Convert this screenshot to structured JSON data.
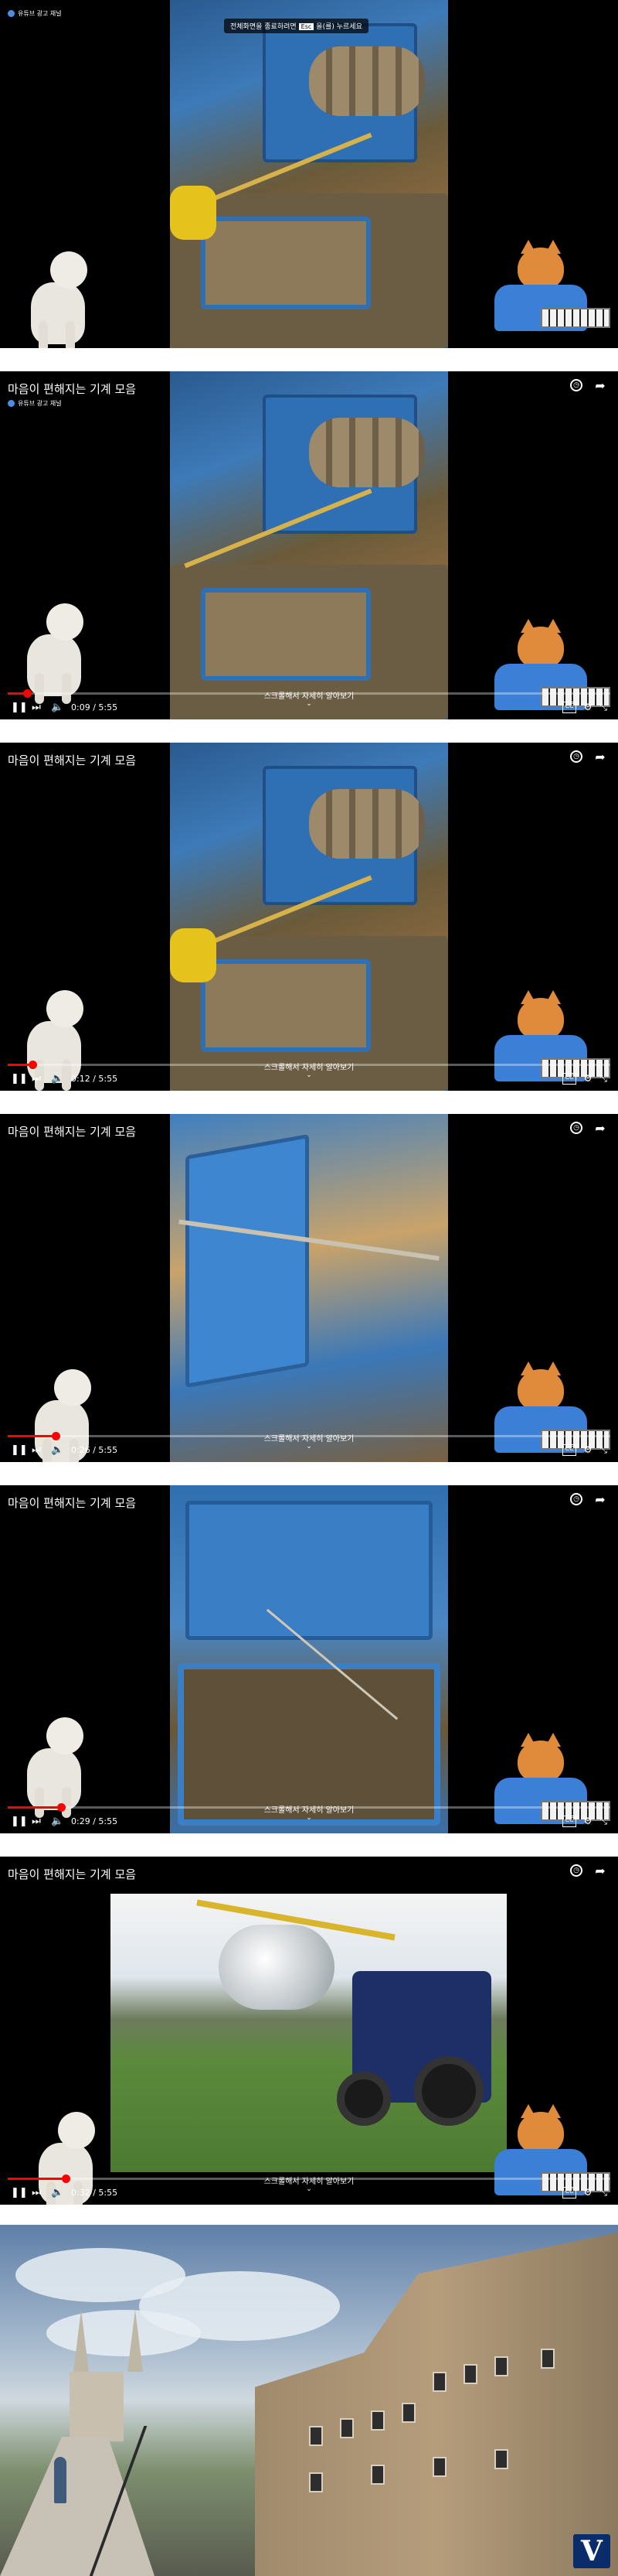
{
  "frames": [
    {
      "title": "",
      "channel": "유튜브 광고 채널",
      "overlay_text": "전체화면을 종료하려면",
      "overlay_key": "Esc",
      "overlay_suffix": "을(를) 누르세요",
      "time": "",
      "progress": 0.0,
      "scroll_hint": "",
      "video": "machine"
    },
    {
      "title": "마음이 편해지는 기계 모음",
      "channel": "유튜브 광고 채널",
      "time": "0:09 / 5:55",
      "progress": 0.025,
      "scroll_hint": "스크롤해서 자세히 알아보기",
      "video": "machine"
    },
    {
      "title": "마음이 편해지는 기계 모음",
      "time": "0:12 / 5:55",
      "progress": 0.034,
      "scroll_hint": "스크롤해서 자세히 알아보기",
      "video": "machine"
    },
    {
      "title": "마음이 편해지는 기계 모음",
      "time": "0:26 / 5:55",
      "progress": 0.073,
      "scroll_hint": "스크롤해서 자세히 알아보기",
      "video": "machine-close"
    },
    {
      "title": "마음이 편해지는 기계 모음",
      "time": "0:29 / 5:55",
      "progress": 0.082,
      "scroll_hint": "스크롤해서 자세히 알아보기",
      "video": "machine-wide"
    },
    {
      "title": "마음이 편해지는 기계 모음",
      "time": "0:32 / 5:55",
      "progress": 0.09,
      "scroll_hint": "스크롤해서 자세히 알아보기",
      "video": "tractor"
    }
  ],
  "icons": {
    "watch_later": "clock-icon",
    "share": "share-icon",
    "play_pause": "pause-icon",
    "next": "next-icon",
    "volume": "volume-icon",
    "subtitles": "cc-icon",
    "settings": "gear-icon",
    "fullscreen": "exit-fullscreen-icon"
  },
  "campus": {
    "logo_letter": "V"
  },
  "colors": {
    "progress": "#ff0000",
    "logo_bg": "#0b2c6b"
  }
}
